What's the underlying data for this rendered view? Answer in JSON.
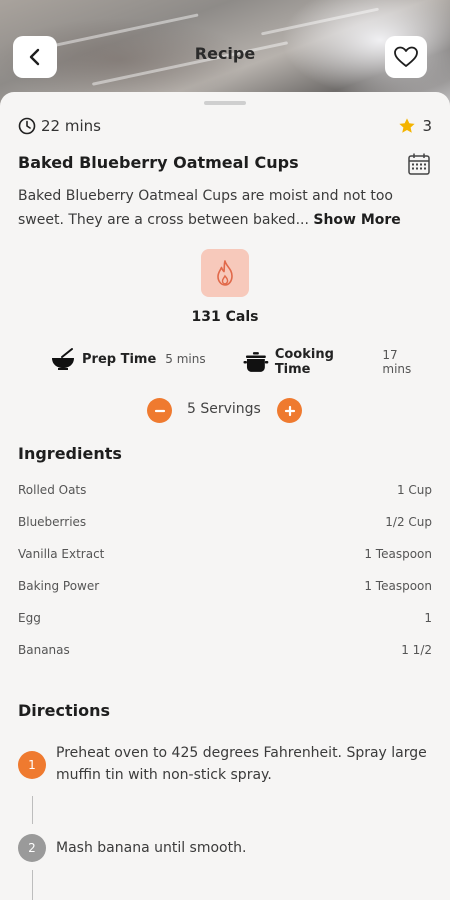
{
  "header": {
    "title": "Recipe"
  },
  "recipe": {
    "time": "22 mins",
    "rating": "3",
    "name": "Baked Blueberry Oatmeal Cups",
    "description": "Baked Blueberry Oatmeal Cups are moist and not too sweet. They are a cross between baked...",
    "show_more": "Show More",
    "calories": "131 Cals",
    "prep_label": "Prep Time",
    "prep_value": "5 mins",
    "cook_label": "Cooking Time",
    "cook_value": "17 mins",
    "servings": "5 Servings"
  },
  "ingredients": {
    "heading": "Ingredients",
    "items": [
      {
        "name": "Rolled Oats",
        "qty": "1 Cup"
      },
      {
        "name": "Blueberries",
        "qty": "1/2 Cup"
      },
      {
        "name": "Vanilla Extract",
        "qty": "1 Teaspoon"
      },
      {
        "name": "Baking Power",
        "qty": "1 Teaspoon"
      },
      {
        "name": "Egg",
        "qty": "1"
      },
      {
        "name": "Bananas",
        "qty": "1 1/2"
      }
    ]
  },
  "directions": {
    "heading": "Directions",
    "steps": [
      {
        "num": "1",
        "text": "Preheat oven to 425 degrees Fahrenheit. Spray large muffin tin with non-stick spray."
      },
      {
        "num": "2",
        "text": "Mash banana until smooth."
      }
    ]
  },
  "colors": {
    "accent": "#ef7a2f",
    "accent_soft": "#f7c9bb",
    "star": "#f4b400",
    "step_inactive": "#9a9a9a"
  },
  "icons": [
    "chevron-left-icon",
    "heart-icon",
    "clock-icon",
    "star-icon",
    "calendar-icon",
    "flame-icon",
    "mixing-bowl-icon",
    "cooking-pot-icon",
    "minus-icon",
    "plus-icon"
  ]
}
